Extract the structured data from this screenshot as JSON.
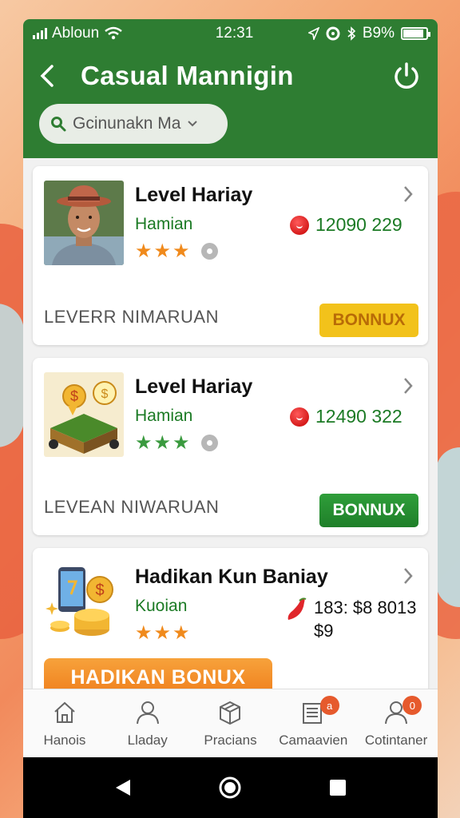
{
  "status": {
    "carrier": "Abloun",
    "time": "12:31",
    "battery": "B9%",
    "battery_level": 0.89
  },
  "header": {
    "title": "Casual Mannigin",
    "search_placeholder": "Gcinunakn Ma"
  },
  "cards": [
    {
      "title": "Level Hariay",
      "subtitle": "Hamian",
      "stars": 3,
      "amount": "12090 229",
      "footer": "LEVERR NIMARUAN",
      "button": "BONNUX",
      "star_color": "#f08a1c",
      "button_color": "#f2c21b"
    },
    {
      "title": "Level Hariay",
      "subtitle": "Hamian",
      "stars": 3,
      "amount": "12490 322",
      "footer": "LEVEAN NIWARUAN",
      "button": "BONNUX",
      "star_color": "#3a9a3f",
      "button_color": "#2f9e3a"
    },
    {
      "title": "Hadikan Kun Baniay",
      "subtitle": "Kuoian",
      "stars": 3,
      "amount_line1": "183: $8 8013",
      "amount_line2": "$9",
      "promo": "HADIKAN BONUX",
      "star_color": "#f08a1c"
    }
  ],
  "tabs": [
    {
      "label": "Hanois",
      "icon": "home-icon"
    },
    {
      "label": "Lladay",
      "icon": "person-icon"
    },
    {
      "label": "Pracians",
      "icon": "box-icon"
    },
    {
      "label": "Camaavien",
      "icon": "news-icon",
      "badge": "a"
    },
    {
      "label": "Cotintaner",
      "icon": "user-icon",
      "badge": "0"
    }
  ],
  "colors": {
    "primary": "#2e7d32",
    "accent": "#ef7e1c"
  }
}
